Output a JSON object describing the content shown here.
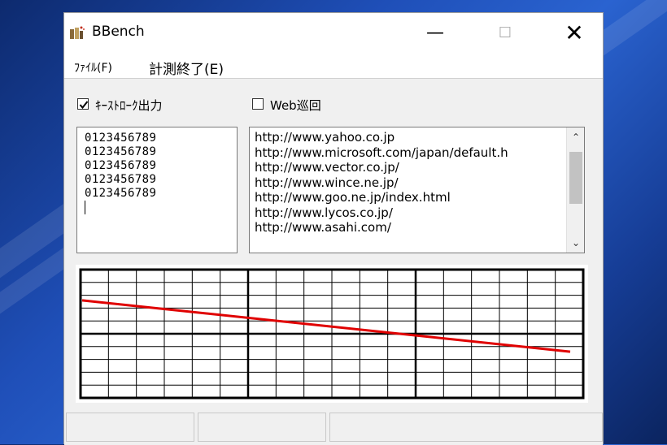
{
  "window": {
    "title": "BBench",
    "icon": "bbench-app-icon",
    "controls": {
      "minimize": "—",
      "maximize": "☐",
      "close": "✕"
    }
  },
  "menu": {
    "file": "ﾌｧｲﾙ(F)",
    "stop": "計測終了(E)"
  },
  "options": {
    "keystroke": {
      "label": "ｷｰｽﾄﾛｰｸ出力",
      "checked": true
    },
    "web_patrol": {
      "label": "Web巡回",
      "checked": false
    }
  },
  "keystroke_output": {
    "lines": [
      "0123456789",
      "0123456789",
      "0123456789",
      "0123456789",
      "0123456789"
    ]
  },
  "url_list": {
    "items": [
      "http://www.yahoo.co.jp",
      "http://www.microsoft.com/japan/default.h",
      "http://www.vector.co.jp/",
      "http://www.wince.ne.jp/",
      "http://www.goo.ne.jp/index.html",
      "http://www.lycos.co.jp/",
      "http://www.asahi.com/"
    ]
  },
  "graph": {
    "line_color": "#e00000",
    "grid_color": "#000000"
  },
  "statusbar": {
    "panes": [
      "",
      "",
      ""
    ]
  }
}
